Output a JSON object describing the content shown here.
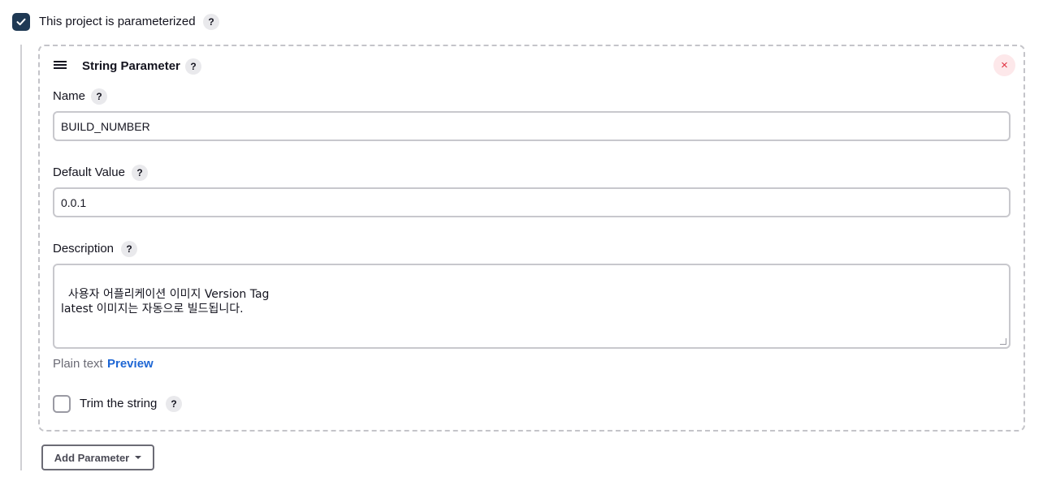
{
  "parameterized": {
    "label": "This project is parameterized",
    "checked": true,
    "help": "?"
  },
  "card": {
    "title": "String Parameter",
    "help": "?",
    "close": "×"
  },
  "fields": {
    "name": {
      "label": "Name",
      "help": "?",
      "value": "BUILD_NUMBER"
    },
    "default_value": {
      "label": "Default Value",
      "help": "?",
      "value": "0.0.1"
    },
    "description": {
      "label": "Description",
      "help": "?",
      "value": "사용자 어플리케이션 이미지 Version Tag\nlatest 이미지는 자동으로 빌드됩니다."
    }
  },
  "format": {
    "plain_text": "Plain text",
    "preview": "Preview"
  },
  "trim": {
    "label": "Trim the string",
    "checked": false,
    "help": "?"
  },
  "add_parameter": {
    "label": "Add Parameter"
  }
}
